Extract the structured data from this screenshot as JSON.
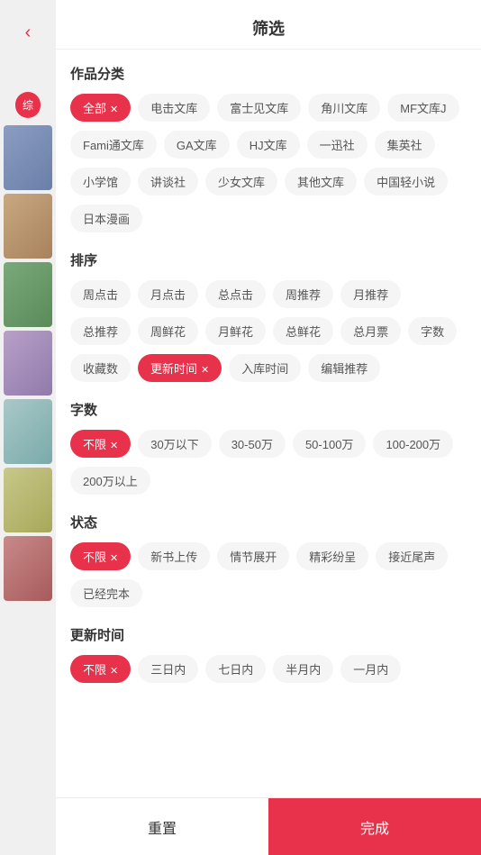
{
  "header": {
    "title": "筛选",
    "back_label": "‹"
  },
  "left": {
    "tag_label": "综",
    "cards": [
      "c1",
      "c2",
      "c3",
      "c4",
      "c5",
      "c6",
      "c7"
    ]
  },
  "sections": [
    {
      "id": "category",
      "title": "作品分类",
      "tags": [
        {
          "label": "全部",
          "active": true,
          "has_close": true
        },
        {
          "label": "电击文库",
          "active": false,
          "has_close": false
        },
        {
          "label": "富士见文库",
          "active": false,
          "has_close": false
        },
        {
          "label": "角川文库",
          "active": false,
          "has_close": false
        },
        {
          "label": "MF文库J",
          "active": false,
          "has_close": false
        },
        {
          "label": "Fami通文库",
          "active": false,
          "has_close": false
        },
        {
          "label": "GA文库",
          "active": false,
          "has_close": false
        },
        {
          "label": "HJ文库",
          "active": false,
          "has_close": false
        },
        {
          "label": "一迅社",
          "active": false,
          "has_close": false
        },
        {
          "label": "集英社",
          "active": false,
          "has_close": false
        },
        {
          "label": "小学馆",
          "active": false,
          "has_close": false
        },
        {
          "label": "讲谈社",
          "active": false,
          "has_close": false
        },
        {
          "label": "少女文库",
          "active": false,
          "has_close": false
        },
        {
          "label": "其他文库",
          "active": false,
          "has_close": false
        },
        {
          "label": "中国轻小说",
          "active": false,
          "has_close": false
        },
        {
          "label": "日本漫画",
          "active": false,
          "has_close": false
        }
      ]
    },
    {
      "id": "sort",
      "title": "排序",
      "tags": [
        {
          "label": "周点击",
          "active": false,
          "has_close": false
        },
        {
          "label": "月点击",
          "active": false,
          "has_close": false
        },
        {
          "label": "总点击",
          "active": false,
          "has_close": false
        },
        {
          "label": "周推荐",
          "active": false,
          "has_close": false
        },
        {
          "label": "月推荐",
          "active": false,
          "has_close": false
        },
        {
          "label": "总推荐",
          "active": false,
          "has_close": false
        },
        {
          "label": "周鲜花",
          "active": false,
          "has_close": false
        },
        {
          "label": "月鲜花",
          "active": false,
          "has_close": false
        },
        {
          "label": "总鲜花",
          "active": false,
          "has_close": false
        },
        {
          "label": "总月票",
          "active": false,
          "has_close": false
        },
        {
          "label": "字数",
          "active": false,
          "has_close": false
        },
        {
          "label": "收藏数",
          "active": false,
          "has_close": false
        },
        {
          "label": "更新时间",
          "active": true,
          "has_close": true
        },
        {
          "label": "入库时间",
          "active": false,
          "has_close": false
        },
        {
          "label": "编辑推荐",
          "active": false,
          "has_close": false
        }
      ]
    },
    {
      "id": "wordcount",
      "title": "字数",
      "tags": [
        {
          "label": "不限",
          "active": true,
          "has_close": true
        },
        {
          "label": "30万以下",
          "active": false,
          "has_close": false
        },
        {
          "label": "30-50万",
          "active": false,
          "has_close": false
        },
        {
          "label": "50-100万",
          "active": false,
          "has_close": false
        },
        {
          "label": "100-200万",
          "active": false,
          "has_close": false
        },
        {
          "label": "200万以上",
          "active": false,
          "has_close": false
        }
      ]
    },
    {
      "id": "status",
      "title": "状态",
      "tags": [
        {
          "label": "不限",
          "active": true,
          "has_close": true
        },
        {
          "label": "新书上传",
          "active": false,
          "has_close": false
        },
        {
          "label": "情节展开",
          "active": false,
          "has_close": false
        },
        {
          "label": "精彩纷呈",
          "active": false,
          "has_close": false
        },
        {
          "label": "接近尾声",
          "active": false,
          "has_close": false
        },
        {
          "label": "已经完本",
          "active": false,
          "has_close": false
        }
      ]
    },
    {
      "id": "update_time",
      "title": "更新时间",
      "tags": [
        {
          "label": "不限",
          "active": true,
          "has_close": true
        },
        {
          "label": "三日内",
          "active": false,
          "has_close": false
        },
        {
          "label": "七日内",
          "active": false,
          "has_close": false
        },
        {
          "label": "半月内",
          "active": false,
          "has_close": false
        },
        {
          "label": "一月内",
          "active": false,
          "has_close": false
        }
      ]
    }
  ],
  "footer": {
    "reset_label": "重置",
    "confirm_label": "完成"
  },
  "colors": {
    "accent": "#e8314a",
    "text_primary": "#333333",
    "text_secondary": "#555555",
    "tag_bg": "#f5f5f5"
  }
}
